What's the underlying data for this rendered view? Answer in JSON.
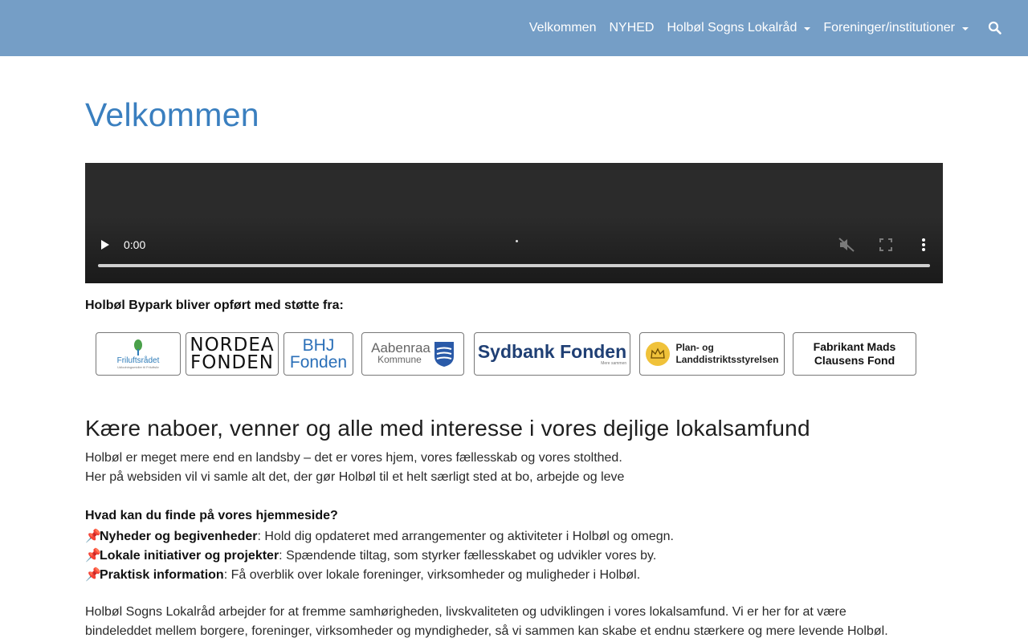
{
  "nav": {
    "items": [
      {
        "label": "Velkommen",
        "dropdown": false
      },
      {
        "label": "NYHED",
        "dropdown": false
      },
      {
        "label": "Holbøl Sogns Lokalråd",
        "dropdown": true
      },
      {
        "label": "Foreninger/institutioner",
        "dropdown": true
      }
    ],
    "search_icon": "search-icon",
    "bg_color": "#759ec6"
  },
  "page": {
    "title": "Velkommen",
    "title_color": "#3a7fbf"
  },
  "video": {
    "time": "0:00",
    "icons": [
      "play-icon",
      "mute-icon",
      "fullscreen-icon",
      "more-icon"
    ]
  },
  "support": {
    "text": "Holbøl Bypark bliver opført med støtte fra:",
    "logos": {
      "friluft_line1": "Friluftsrådet",
      "friluft_line2": "Udlodningsmidler til Friluftsliv",
      "nordea_line1": "NORDEA",
      "nordea_line2": "FONDEN",
      "bhj_line1": "BHJ",
      "bhj_line2": "Fonden",
      "aabenraa_line1": "Aabenraa",
      "aabenraa_line2": "Kommune",
      "sydbank_line1": "Sydbank Fonden",
      "sydbank_line2": "Mere sammen",
      "plan_line1": "Plan- og",
      "plan_line2": "Landdistriktsstyrelsen",
      "mads_line1": "Fabrikant Mads",
      "mads_line2": "Clausens Fond"
    }
  },
  "content": {
    "heading": "Kære naboer, venner og alle med interesse i vores dejlige lokalsamfund",
    "intro1": "Holbøl er meget mere end en landsby – det er vores hjem, vores fællesskab og vores stolthed.",
    "intro2": "Her på websiden vil vi samle alt det, der gør Holbøl til et helt særligt sted at bo, arbejde og leve",
    "question": "Hvad kan du finde på vores hjemmeside?",
    "pin": "📌",
    "bullets": [
      {
        "title": "Nyheder og begivenheder",
        "text": ": Hold dig opdateret med arrangementer og aktiviteter i Holbøl og omegn."
      },
      {
        "title": "Lokale initiativer og projekter",
        "text": ": Spændende tiltag, som styrker fællesskabet og udvikler vores by."
      },
      {
        "title": "Praktisk information",
        "text": ": Få overblik over lokale foreninger, virksomheder og muligheder i Holbøl."
      }
    ],
    "outro1": "Holbøl Sogns Lokalråd arbejder for at fremme samhørigheden, livskvaliteten og udviklingen i vores lokalsamfund. Vi er her for at være",
    "outro2": "bindeleddet mellem borgere, foreninger, virksomheder og myndigheder, så vi sammen kan skabe et endnu stærkere og mere levende Holbøl."
  }
}
